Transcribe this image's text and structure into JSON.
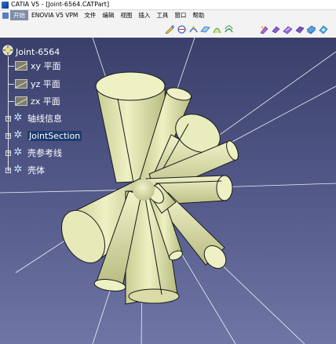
{
  "window": {
    "title": "CATIA V5 - [Joint-6564.CATPart]"
  },
  "menubar": {
    "items": [
      "开始",
      "ENOVIA V5 VPM",
      "文件",
      "编辑",
      "视图",
      "插入",
      "工具",
      "窗口",
      "帮助"
    ]
  },
  "toolbar": {
    "icons": [
      "sketch-icon",
      "measure-icon",
      "constraint-icon",
      "plane-icon",
      "grid-icon",
      "snap-icon",
      "paint-icon",
      "wire-icon",
      "surface-icon",
      "solid-icon",
      "render-icon",
      "fill-icon"
    ]
  },
  "tree": {
    "root": {
      "label": "Joint-6564",
      "icon": "part-icon"
    },
    "nodes": [
      {
        "label": "xy 平面",
        "icon": "plane-icon"
      },
      {
        "label": "yz 平面",
        "icon": "plane-icon"
      },
      {
        "label": "zx 平面",
        "icon": "plane-icon"
      },
      {
        "label": "轴线信息",
        "icon": "geometrical-set-icon"
      },
      {
        "label": "JointSection",
        "icon": "geometrical-set-icon"
      },
      {
        "label": "壳参考线",
        "icon": "geometrical-set-icon"
      },
      {
        "label": "壳体",
        "icon": "body-icon"
      }
    ]
  },
  "viewport": {
    "background_top": "#3a3f6a",
    "background_bottom": "#6f76a6",
    "model_color": "#e4e8b4",
    "line_color": "#ffffff"
  }
}
